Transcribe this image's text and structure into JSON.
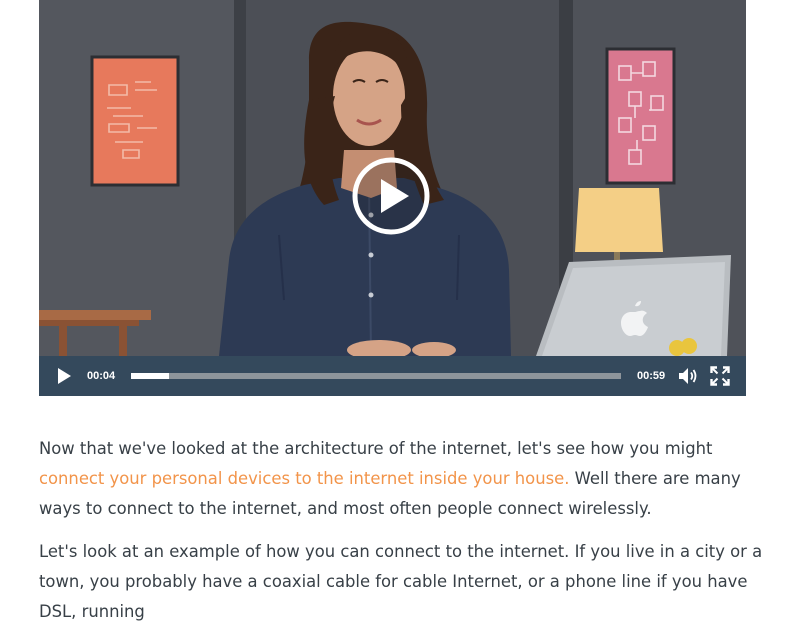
{
  "player": {
    "current_time": "00:04",
    "total_time": "00:59",
    "progress_fraction": 0.078,
    "icons": {
      "big_play": "play-circle-icon",
      "play": "play-icon",
      "volume": "volume-icon",
      "fullscreen": "fullscreen-icon"
    },
    "colors": {
      "control_bar": "#34495c",
      "progress_track": "#8e959b",
      "progress_fill": "#ffffff"
    }
  },
  "article": {
    "p1_before": "Now that we've looked at the architecture of the internet, let's see how you might ",
    "p1_link": "connect your personal devices to the internet inside your house.",
    "p1_after": " Well there are many ways to connect to the internet, and most often people connect wirelessly.",
    "p2": "Let's look at an example of how you can connect to the internet. If you live in a city or a town, you probably have a coaxial cable for cable Internet, or a phone line if you have DSL, running",
    "link_color": "#f2944a",
    "text_color": "#384047"
  }
}
